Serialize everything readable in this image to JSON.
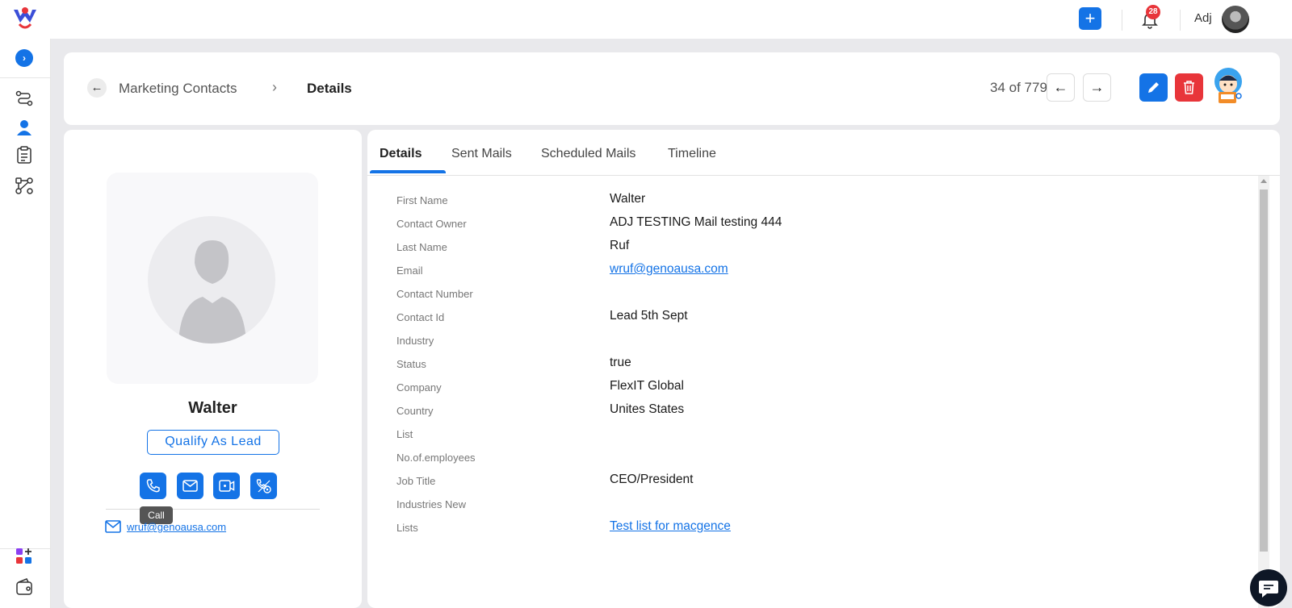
{
  "app": {
    "logo_icon": "app-logo-icon",
    "accent_color": "#1473e6",
    "danger_color": "#e8353a"
  },
  "topbar": {
    "add_icon": "plus-icon",
    "notifications_icon": "bell-icon",
    "notification_count": "28",
    "user_name": "Adj"
  },
  "rail": {
    "items": [
      "expand-icon",
      "workflow-icon",
      "contacts-icon",
      "clipboard-icon",
      "diagram-icon",
      "apps-icon",
      "wallet-icon"
    ]
  },
  "header": {
    "breadcrumb_parent": "Marketing Contacts",
    "breadcrumb_separator": "›",
    "breadcrumb_current": "Details",
    "counter": "34 of 7797",
    "prev_label": "←",
    "next_label": "→"
  },
  "profile": {
    "name": "Walter",
    "qualify_label": "Qualify As Lead",
    "actions": [
      "phone-icon",
      "mail-icon",
      "video-icon",
      "call-settings-icon"
    ],
    "tooltip": "Call",
    "email": "wruf@genoausa.com"
  },
  "tabs": [
    "Details",
    "Sent Mails",
    "Scheduled Mails",
    "Timeline"
  ],
  "active_tab": "Details",
  "fields": [
    {
      "label": "First Name",
      "value": "Walter"
    },
    {
      "label": "Contact Owner",
      "value": "ADJ TESTING Mail testing 444"
    },
    {
      "label": "Last Name",
      "value": "Ruf"
    },
    {
      "label": "Email",
      "value": "wruf@genoausa.com"
    },
    {
      "label": "Contact Number",
      "value": ""
    },
    {
      "label": "Contact Id",
      "value": "Lead 5th Sept"
    },
    {
      "label": "Industry",
      "value": ""
    },
    {
      "label": "Status",
      "value": "true"
    },
    {
      "label": "Company",
      "value": "FlexIT Global"
    },
    {
      "label": "Country",
      "value": "Unites States"
    },
    {
      "label": "List",
      "value": ""
    },
    {
      "label": "No.of.employees",
      "value": ""
    },
    {
      "label": "Job Title",
      "value": "CEO/President"
    },
    {
      "label": "Industries New",
      "value": ""
    },
    {
      "label": "Lists",
      "value": "Test list for macgence"
    }
  ]
}
